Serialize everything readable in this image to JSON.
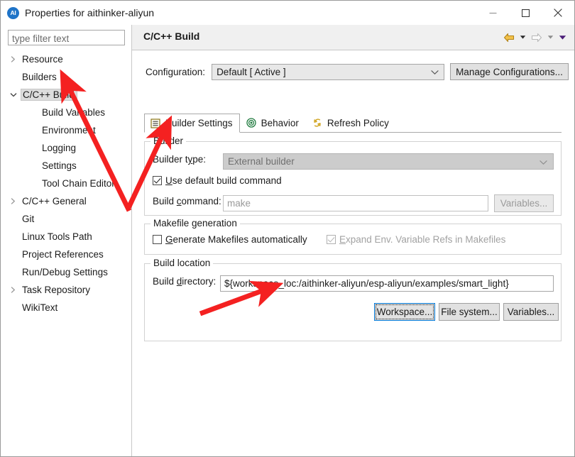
{
  "window": {
    "title": "Properties for aithinker-aliyun",
    "app_icon": "ai-circle-icon",
    "minimize_label": "Minimize",
    "maximize_label": "Maximize",
    "close_label": "Close"
  },
  "sidebar": {
    "filter": {
      "placeholder": "type filter text",
      "value": ""
    },
    "items": [
      {
        "label": "Resource",
        "depth": 1,
        "expandable": true,
        "expanded": false,
        "selected": false
      },
      {
        "label": "Builders",
        "depth": 1,
        "expandable": false,
        "expanded": false,
        "selected": false
      },
      {
        "label": "C/C++ Build",
        "depth": 1,
        "expandable": true,
        "expanded": true,
        "selected": true
      },
      {
        "label": "Build Variables",
        "depth": 2,
        "expandable": false,
        "expanded": false,
        "selected": false
      },
      {
        "label": "Environment",
        "depth": 2,
        "expandable": false,
        "expanded": false,
        "selected": false
      },
      {
        "label": "Logging",
        "depth": 2,
        "expandable": false,
        "expanded": false,
        "selected": false
      },
      {
        "label": "Settings",
        "depth": 2,
        "expandable": false,
        "expanded": false,
        "selected": false
      },
      {
        "label": "Tool Chain Editor",
        "depth": 2,
        "expandable": false,
        "expanded": false,
        "selected": false
      },
      {
        "label": "C/C++ General",
        "depth": 1,
        "expandable": true,
        "expanded": false,
        "selected": false
      },
      {
        "label": "Git",
        "depth": 1,
        "expandable": false,
        "expanded": false,
        "selected": false
      },
      {
        "label": "Linux Tools Path",
        "depth": 1,
        "expandable": false,
        "expanded": false,
        "selected": false
      },
      {
        "label": "Project References",
        "depth": 1,
        "expandable": false,
        "expanded": false,
        "selected": false
      },
      {
        "label": "Run/Debug Settings",
        "depth": 1,
        "expandable": false,
        "expanded": false,
        "selected": false
      },
      {
        "label": "Task Repository",
        "depth": 1,
        "expandable": true,
        "expanded": false,
        "selected": false
      },
      {
        "label": "WikiText",
        "depth": 1,
        "expandable": false,
        "expanded": false,
        "selected": false
      }
    ]
  },
  "page": {
    "title": "C/C++ Build",
    "nav": {
      "back_icon": "back-arrow-icon",
      "back_menu_icon": "chevron-down-icon",
      "forward_icon": "forward-arrow-icon",
      "forward_menu_icon": "chevron-down-icon",
      "overflow_icon": "chevron-down-filled-icon"
    }
  },
  "configuration": {
    "label": "Configuration:",
    "selected": "Default  [ Active ]",
    "manage_button": "Manage Configurations..."
  },
  "tabs": [
    {
      "label": "Builder Settings",
      "icon": "list-lines-icon",
      "active": true
    },
    {
      "label": "Behavior",
      "icon": "target-circle-icon",
      "active": false
    },
    {
      "label": "Refresh Policy",
      "icon": "refresh-arrows-icon",
      "active": false
    }
  ],
  "builder_group": {
    "title": "Builder",
    "builder_type_label": "Builder type:",
    "builder_type_value": "External builder",
    "use_default_build_command": {
      "label": "Use default build command",
      "checked": true,
      "enabled": true
    },
    "build_command_label": "Build command:",
    "build_command_value": "make",
    "build_command_enabled": false,
    "variables_button": "Variables...",
    "variables_enabled": false
  },
  "makefile_group": {
    "title": "Makefile generation",
    "generate_makefiles": {
      "label": "Generate Makefiles automatically",
      "checked": false,
      "enabled": true
    },
    "expand_env_refs": {
      "label": "Expand Env. Variable Refs in Makefiles",
      "checked": true,
      "enabled": false
    }
  },
  "build_location_group": {
    "title": "Build location",
    "build_directory_label": "Build directory:",
    "build_directory_value": "${workspace_loc:/aithinker-aliyun/esp-aliyun/examples/smart_light}",
    "buttons": [
      {
        "label": "Workspace...",
        "focused": true
      },
      {
        "label": "File system...",
        "focused": false
      },
      {
        "label": "Variables...",
        "focused": false
      }
    ]
  },
  "annotations": {
    "color": "#f42121",
    "arrows": [
      {
        "name": "arrow-to-cpp-build-tree-item"
      },
      {
        "name": "arrow-to-builder-settings-tab"
      },
      {
        "name": "arrow-to-build-directory-field"
      }
    ]
  }
}
